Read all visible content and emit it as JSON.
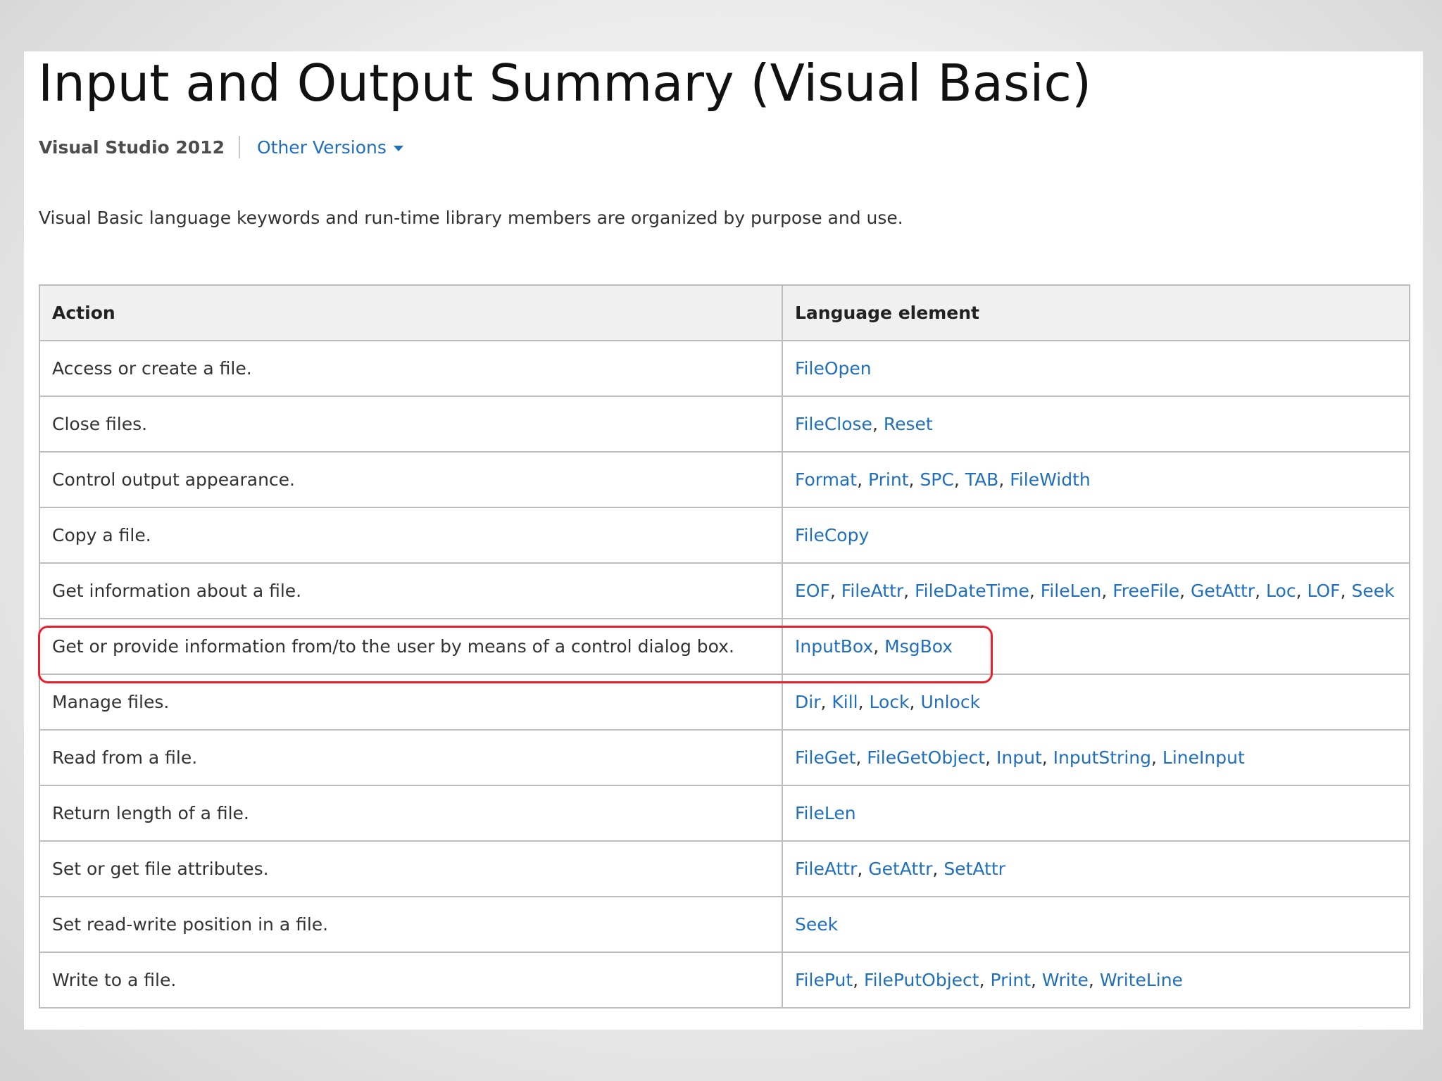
{
  "page": {
    "title": "Input and Output Summary (Visual Basic)",
    "product": "Visual Studio 2012",
    "other_versions": "Other Versions",
    "intro": "Visual Basic language keywords and run-time library members are organized by purpose and use."
  },
  "table": {
    "headers": [
      "Action",
      "Language element"
    ],
    "rows": [
      {
        "action": "Access or create a file.",
        "elements": [
          "FileOpen"
        ]
      },
      {
        "action": "Close files.",
        "elements": [
          "FileClose",
          "Reset"
        ]
      },
      {
        "action": "Control output appearance.",
        "elements": [
          "Format",
          "Print",
          "SPC",
          "TAB",
          "FileWidth"
        ]
      },
      {
        "action": "Copy a file.",
        "elements": [
          "FileCopy"
        ]
      },
      {
        "action": "Get information about a file.",
        "elements": [
          "EOF",
          "FileAttr",
          "FileDateTime",
          "FileLen",
          "FreeFile",
          "GetAttr",
          "Loc",
          "LOF",
          "Seek"
        ]
      },
      {
        "action": "Get or provide information from/to the user by means of a control dialog box.",
        "elements": [
          "InputBox",
          "MsgBox"
        ]
      },
      {
        "action": "Manage files.",
        "elements": [
          "Dir",
          "Kill",
          "Lock",
          "Unlock"
        ]
      },
      {
        "action": "Read from a file.",
        "elements": [
          "FileGet",
          "FileGetObject",
          "Input",
          "InputString",
          "LineInput"
        ]
      },
      {
        "action": "Return length of a file.",
        "elements": [
          "FileLen"
        ]
      },
      {
        "action": "Set or get file attributes.",
        "elements": [
          "FileAttr",
          "GetAttr",
          "SetAttr"
        ]
      },
      {
        "action": "Set read-write position in a file.",
        "elements": [
          "Seek"
        ]
      },
      {
        "action": "Write to a file.",
        "elements": [
          "FilePut",
          "FilePutObject",
          "Print",
          "Write",
          "WriteLine"
        ]
      }
    ],
    "highlighted_row": 5
  },
  "colors": {
    "link": "#1f6fbd",
    "highlight": "#e8202c",
    "header_bg": "#f0f0f0",
    "border": "#bdbdbd"
  },
  "icons": {
    "other_versions_dropdown": "caret-down-icon"
  }
}
